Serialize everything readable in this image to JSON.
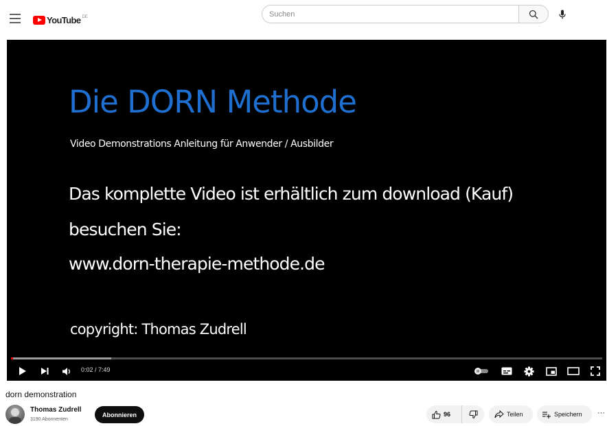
{
  "header": {
    "logo_text": "YouTube",
    "logo_region": "DE",
    "search_placeholder": "Suchen"
  },
  "video_frame": {
    "title": "Die DORN Methode",
    "subtitle": "Video Demonstrations Anleitung für Anwender / Ausbilder",
    "line1": "Das komplette Video ist erhältlich zum download (Kauf)",
    "line2": "besuchen Sie:",
    "line3": "www.dorn-therapie-methode.de",
    "copyright": "copyright: Thomas Zudrell",
    "title_color": "#1e6fd0"
  },
  "player": {
    "time": "0:02 / 7:49",
    "progress_fraction": 0.004,
    "buffer_fraction": 0.17,
    "icons": [
      "play-icon",
      "next-icon",
      "volume-icon",
      "autoplay-toggle-icon",
      "subtitles-icon",
      "settings-icon",
      "miniplayer-icon",
      "theater-icon",
      "fullscreen-icon"
    ]
  },
  "video_info": {
    "title": "dorn demonstration",
    "channel_name": "Thomas Zudrell",
    "subscribers": "3190 Abonnenten",
    "subscribe_label": "Abonnieren",
    "likes": "96",
    "share_label": "Teilen",
    "save_label": "Speichern",
    "more_label": "···"
  },
  "colors": {
    "accent_red": "#ff0000",
    "subscribe_bg": "#0f0f0f"
  }
}
